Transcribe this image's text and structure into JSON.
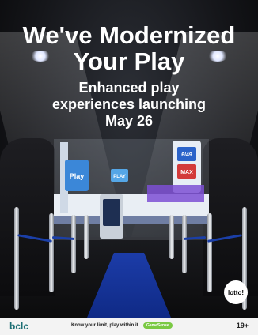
{
  "headline": {
    "line1": "We've Modernized",
    "line2": "Your Play"
  },
  "subline": {
    "line1": "Enhanced play",
    "line2": "experiences launching",
    "line3": "May 26"
  },
  "store": {
    "kiosk_left_screen": "Play",
    "kiosk_right_screens": [
      "6/49",
      "MAX"
    ],
    "counter_sign": "PLAY"
  },
  "badge": {
    "label": "lotto!"
  },
  "footer": {
    "brand": "bclc",
    "tagline": "Know your limit, play within it.",
    "gamesense": "GameSense",
    "age": "19+"
  },
  "colors": {
    "carpet": "#1c3ca8",
    "rope": "#1b3fa8",
    "gamesense": "#7ac943",
    "brand": "#1b6e73"
  }
}
